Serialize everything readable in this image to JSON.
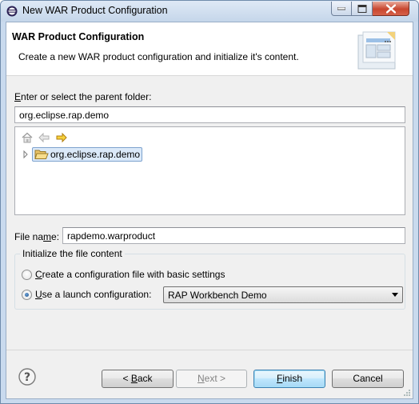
{
  "window": {
    "title": "New WAR Product Configuration"
  },
  "banner": {
    "title": "WAR Product Configuration",
    "description": "Create a new WAR product configuration and initialize it's content."
  },
  "folder": {
    "label": "Enter or select the parent folder:",
    "value": "org.eclipse.rap.demo"
  },
  "tree": {
    "toolbar": [
      "home-icon",
      "back-arrow-icon",
      "forward-arrow-icon"
    ],
    "items": [
      {
        "label": "org.eclipse.rap.demo",
        "icon": "open-folder-icon",
        "selected": true
      }
    ]
  },
  "file": {
    "label": "File name:",
    "value": "rapdemo.warproduct"
  },
  "init_group": {
    "title": "Initialize the file content",
    "option_basic": "Create a configuration file with basic settings",
    "option_launch": "Use a launch configuration:",
    "selected_option": "option_launch",
    "launch_config": "RAP Workbench Demo"
  },
  "buttons": {
    "back": "< Back",
    "next": "Next >",
    "finish": "Finish",
    "cancel": "Cancel"
  },
  "colors": {
    "accent": "#3c7fb1",
    "selection": "#dbe9f9",
    "frame": "#c9daee",
    "close_button": "#c8462f"
  }
}
